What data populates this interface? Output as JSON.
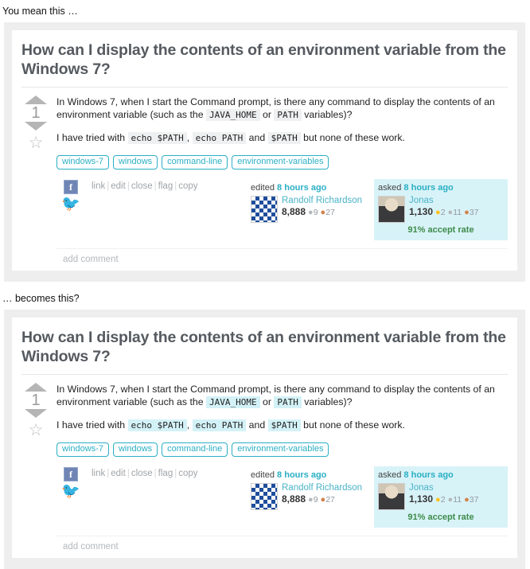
{
  "captions": {
    "before": "You mean this …",
    "after": "… becomes this?"
  },
  "question": {
    "title": "How can I display the contents of an environment variable from the Windows 7?",
    "vote_count": "1",
    "paragraph1_pre": "In Windows 7, when I start the Command prompt, is there any command to display the contents of an environment variable (such as the ",
    "code_java_home": "JAVA_HOME",
    "paragraph1_mid": " or ",
    "code_path": "PATH",
    "paragraph1_post": " variables)?",
    "paragraph2_pre": "I have tried with ",
    "code_echo_dollar_path": "echo $PATH",
    "paragraph2_comma": ", ",
    "code_echo_path": "echo PATH",
    "paragraph2_and": " and ",
    "code_dollar_path": "$PATH",
    "paragraph2_post": " but none of these work.",
    "tags": [
      "windows-7",
      "windows",
      "command-line",
      "environment-variables"
    ],
    "actions": [
      "link",
      "edit",
      "close",
      "flag",
      "copy"
    ],
    "action_separator": "|",
    "add_comment": "add comment",
    "social": {
      "facebook_glyph": "f",
      "twitter_glyph": "🐦"
    },
    "edited_card": {
      "action_label": "edited",
      "time": "8 hours ago",
      "username": "Randolf Richardson",
      "reputation": "8,888",
      "badges": [
        {
          "type": "silver",
          "count": "9"
        },
        {
          "type": "bronze",
          "count": "27"
        }
      ]
    },
    "asked_card": {
      "action_label": "asked",
      "time": "8 hours ago",
      "username": "Jonas",
      "reputation": "1,130",
      "badges": [
        {
          "type": "gold",
          "count": "2"
        },
        {
          "type": "silver",
          "count": "11"
        },
        {
          "type": "bronze",
          "count": "37"
        }
      ],
      "accept_rate": "91% accept rate"
    }
  },
  "colors": {
    "tag_accent": "#2aafc4",
    "link_accent": "#4ab3c8",
    "accept_green": "#3d8b4a",
    "code_bg_before": "#eff0f1",
    "code_bg_after": "#d3f2f7",
    "asked_card_bg": "#d8f3f8",
    "panel_bg": "#eeeeee"
  }
}
